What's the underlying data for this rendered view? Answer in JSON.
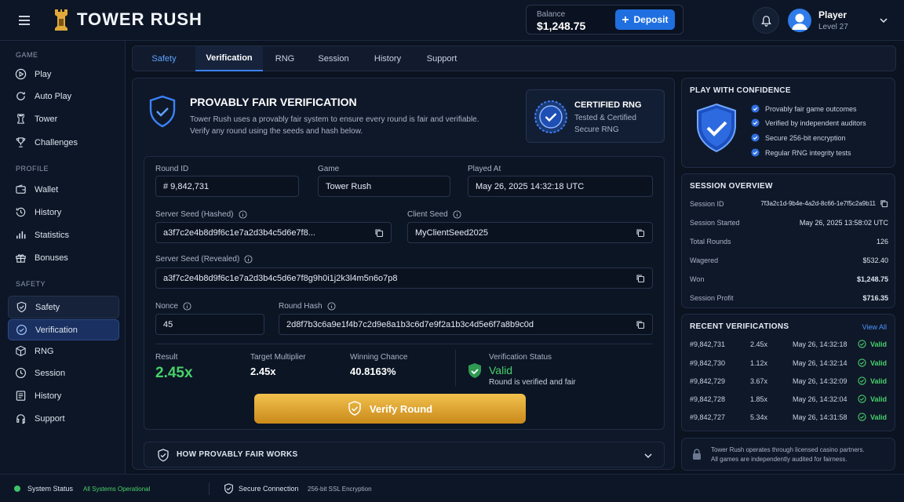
{
  "app": {
    "name": "TOWER RUSH"
  },
  "header": {
    "balance_label": "Balance",
    "balance_value": "$1,248.75",
    "deposit_label": "Deposit",
    "user_name": "Player",
    "user_level": "Level 27"
  },
  "sidebar": {
    "game_label": "GAME",
    "profile_label": "PROFILE",
    "safety_label": "SAFETY",
    "game": [
      "Play",
      "Auto Play",
      "Tower",
      "Challenges"
    ],
    "profile": [
      "Wallet",
      "History",
      "Statistics",
      "Bonuses"
    ],
    "safety": [
      "Safety",
      "Verification",
      "RNG",
      "Session",
      "History",
      "Support"
    ]
  },
  "tabs": [
    "Safety",
    "Verification",
    "RNG",
    "Session",
    "History",
    "Support"
  ],
  "verification": {
    "title": "PROVABLY FAIR VERIFICATION",
    "desc1": "Tower Rush uses a provably fair system to ensure every round is fair and verifiable.",
    "desc2": "Verify any round using the seeds and hash below.",
    "cert_title": "CERTIFIED RNG",
    "cert_l1": "Tested & Certified",
    "cert_l2": "Secure RNG"
  },
  "fields": {
    "round_id_label": "Round ID",
    "round_id_value": "# 9,842,731",
    "game_label": "Game",
    "game_value": "Tower Rush",
    "played_label": "Played At",
    "played_value": "May 26, 2025 14:32:18 UTC",
    "server_hashed_label": "Server Seed (Hashed)",
    "server_hashed_value": "a3f7c2e4b8d9f6c1e7a2d3b4c5d6e7f8...",
    "client_label": "Client Seed",
    "client_value": "MyClientSeed2025",
    "server_revealed_label": "Server Seed (Revealed)",
    "server_revealed_value": "a3f7c2e4b8d9f6c1e7a2d3b4c5d6e7f8g9h0i1j2k3l4m5n6o7p8",
    "nonce_label": "Nonce",
    "nonce_value": "45",
    "hash_label": "Round Hash",
    "hash_value": "2d8f7b3c6a9e1f4b7c2d9e8a1b3c6d7e9f2a1b3c4d5e6f7a8b9c0d"
  },
  "result": {
    "result_label": "Result",
    "result_value": "2.45x",
    "target_label": "Target Multiplier",
    "target_value": "2.45x",
    "chance_label": "Winning Chance",
    "chance_value": "40.8163%",
    "status_label": "Verification Status",
    "status_value": "Valid",
    "status_desc": "Round is verified and fair",
    "verify_button": "Verify Round"
  },
  "howto": {
    "label": "HOW PROVABLY FAIR WORKS"
  },
  "confidence": {
    "title": "PLAY WITH CONFIDENCE",
    "items": [
      "Provably fair game outcomes",
      "Verified by independent auditors",
      "Secure 256-bit encryption",
      "Regular RNG integrity tests"
    ]
  },
  "session": {
    "title": "SESSION OVERVIEW",
    "rows": [
      {
        "k": "Session ID",
        "v": "7f3a2c1d-9b4e-4a2d-8c66-1e7f5c2a9b11"
      },
      {
        "k": "Session Started",
        "v": "May 26, 2025 13:58:02 UTC"
      },
      {
        "k": "Total Rounds",
        "v": "126"
      },
      {
        "k": "Wagered",
        "v": "$532.40"
      },
      {
        "k": "Won",
        "v": "$1,248.75"
      },
      {
        "k": "Session Profit",
        "v": "$716.35"
      }
    ]
  },
  "recent": {
    "title": "RECENT VERIFICATIONS",
    "view_all": "View All",
    "rows": [
      {
        "id": "#9,842,731",
        "mult": "2.45x",
        "time": "May 26, 14:32:18",
        "status": "Valid"
      },
      {
        "id": "#9,842,730",
        "mult": "1.12x",
        "time": "May 26, 14:32:14",
        "status": "Valid"
      },
      {
        "id": "#9,842,729",
        "mult": "3.67x",
        "time": "May 26, 14:32:09",
        "status": "Valid"
      },
      {
        "id": "#9,842,728",
        "mult": "1.85x",
        "time": "May 26, 14:32:04",
        "status": "Valid"
      },
      {
        "id": "#9,842,727",
        "mult": "5.34x",
        "time": "May 26, 14:31:58",
        "status": "Valid"
      }
    ]
  },
  "notice": {
    "l1": "Tower Rush operates through licensed casino partners.",
    "l2": "All games are independently audited for fairness."
  },
  "footer": {
    "status_label": "System Status",
    "status_value": "All Systems Operational",
    "secure_label": "Secure Connection",
    "secure_value": "256-bit SSL Encryption"
  }
}
